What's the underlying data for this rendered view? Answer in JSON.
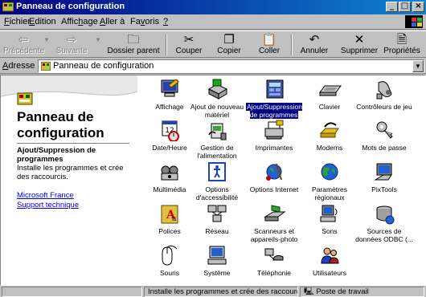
{
  "window": {
    "title": "Panneau de configuration"
  },
  "menu": [
    {
      "label": "Fichier",
      "ul": "F",
      "rest": "ichier"
    },
    {
      "label": "Edition",
      "ul": "E",
      "rest": "dition"
    },
    {
      "label": "Affichage",
      "pre": "Affic",
      "ul": "h",
      "rest": "age"
    },
    {
      "label": "Aller à",
      "ul": "A",
      "rest": "ller à"
    },
    {
      "label": "Favoris",
      "pre": "Fa",
      "ul": "v",
      "rest": "oris"
    },
    {
      "label": "?",
      "ul": "?",
      "rest": ""
    }
  ],
  "toolbar": {
    "back": "Précédente",
    "forward": "Suivante",
    "up": "Dossier parent",
    "cut": "Couper",
    "copy": "Copier",
    "paste": "Coller",
    "undo": "Annuler",
    "delete": "Supprimer",
    "properties": "Propriétés"
  },
  "address": {
    "label_pre": "A",
    "label_rest": "dresse",
    "value": "Panneau de configuration"
  },
  "left_panel": {
    "title": "Panneau de configuration",
    "selected_name": "Ajout/Suppression de programmes",
    "selected_desc": "Installe les programmes et crée des raccourcis.",
    "links": [
      "Microsoft France",
      "Support technique"
    ]
  },
  "icons": [
    {
      "label": "Affichage",
      "icon": "display-icon"
    },
    {
      "label": "Ajout de nouveau matériel",
      "icon": "add-hardware-icon"
    },
    {
      "label": "Ajout/Suppression de programmes",
      "icon": "add-remove-programs-icon",
      "selected": true
    },
    {
      "label": "Clavier",
      "icon": "keyboard-icon"
    },
    {
      "label": "Contrôleurs de jeu",
      "icon": "game-controller-icon"
    },
    {
      "label": "Date/Heure",
      "icon": "date-time-icon"
    },
    {
      "label": "Gestion de l'alimentation",
      "icon": "power-management-icon"
    },
    {
      "label": "Imprimantes",
      "icon": "printers-icon"
    },
    {
      "label": "Modems",
      "icon": "modem-icon"
    },
    {
      "label": "Mots de passe",
      "icon": "passwords-icon"
    },
    {
      "label": "Multimédia",
      "icon": "multimedia-icon"
    },
    {
      "label": "Options d'accessibilité",
      "icon": "accessibility-icon"
    },
    {
      "label": "Options Internet",
      "icon": "internet-options-icon"
    },
    {
      "label": "Paramètres régionaux",
      "icon": "regional-settings-icon"
    },
    {
      "label": "PixTools",
      "icon": "pixtools-icon"
    },
    {
      "label": "Polices",
      "icon": "fonts-icon"
    },
    {
      "label": "Réseau",
      "icon": "network-icon"
    },
    {
      "label": "Scanneurs et appareils-photo",
      "icon": "scanner-icon"
    },
    {
      "label": "Sons",
      "icon": "sounds-icon"
    },
    {
      "label": "Sources de données ODBC (...",
      "icon": "odbc-icon"
    },
    {
      "label": "Souris",
      "icon": "mouse-icon"
    },
    {
      "label": "Système",
      "icon": "system-icon"
    },
    {
      "label": "Téléphonie",
      "icon": "telephony-icon"
    },
    {
      "label": "Utilisateurs",
      "icon": "users-icon"
    }
  ],
  "status": {
    "message": "Installe les programmes et crée des raccourcis.",
    "zone": "Poste de travail"
  },
  "colors": {
    "title_start": "#000080",
    "title_end": "#1084d0",
    "face": "#c0c0c0",
    "selection": "#000080"
  }
}
